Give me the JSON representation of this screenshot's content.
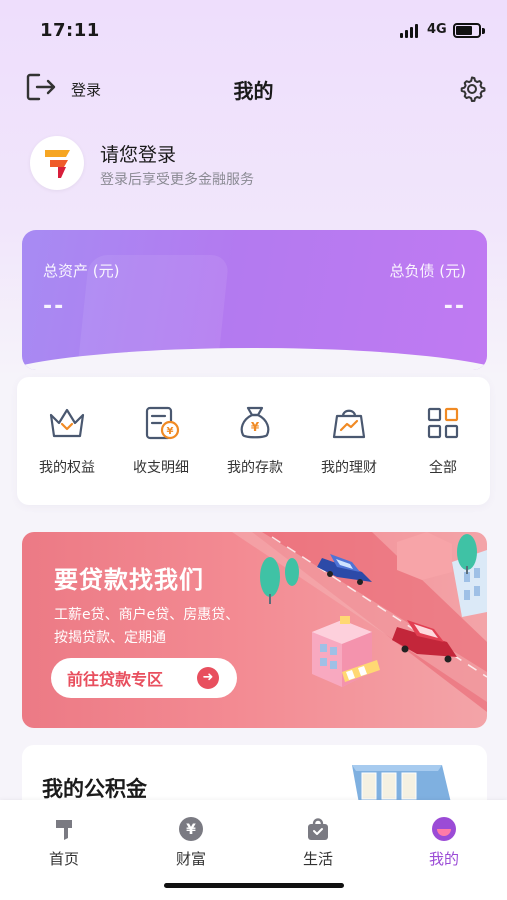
{
  "status_bar": {
    "time": "17:11",
    "network": "4G"
  },
  "header": {
    "login_label": "登录",
    "title": "我的",
    "icons": [
      "login-icon",
      "settings-icon"
    ]
  },
  "profile": {
    "name": "请您登录",
    "subtitle": "登录后享受更多金融服务"
  },
  "assets": {
    "total_assets_label": "总资产 (元)",
    "total_assets_value": "--",
    "total_liabilities_label": "总负债 (元)",
    "total_liabilities_value": "--"
  },
  "quick_menu": [
    {
      "label": "我的权益",
      "icon": "crown-icon"
    },
    {
      "label": "收支明细",
      "icon": "bill-icon"
    },
    {
      "label": "我的存款",
      "icon": "money-bag-icon"
    },
    {
      "label": "我的理财",
      "icon": "shopping-bag-chart-icon"
    },
    {
      "label": "全部",
      "icon": "grid-icon"
    }
  ],
  "loan_banner": {
    "title": "要贷款找我们",
    "subtitle_line1": "工薪e贷、商户e贷、房惠贷、",
    "subtitle_line2": "按揭贷款、定期通",
    "cta": "前往贷款专区"
  },
  "fund": {
    "title": "我的公积金"
  },
  "tab_bar": [
    {
      "label": "首页",
      "icon": "home-logo-icon",
      "active": false
    },
    {
      "label": "财富",
      "icon": "yuan-icon",
      "active": false
    },
    {
      "label": "生活",
      "icon": "life-bag-icon",
      "active": false
    },
    {
      "label": "我的",
      "icon": "profile-face-icon",
      "active": true
    }
  ],
  "colors": {
    "accent": "#9b4bd6",
    "card_gradient_start": "#a78bf3",
    "card_gradient_end": "#c07af2",
    "banner_red": "#e84f5e",
    "icon_orange": "#f08a24",
    "icon_slate": "#4a5870"
  }
}
